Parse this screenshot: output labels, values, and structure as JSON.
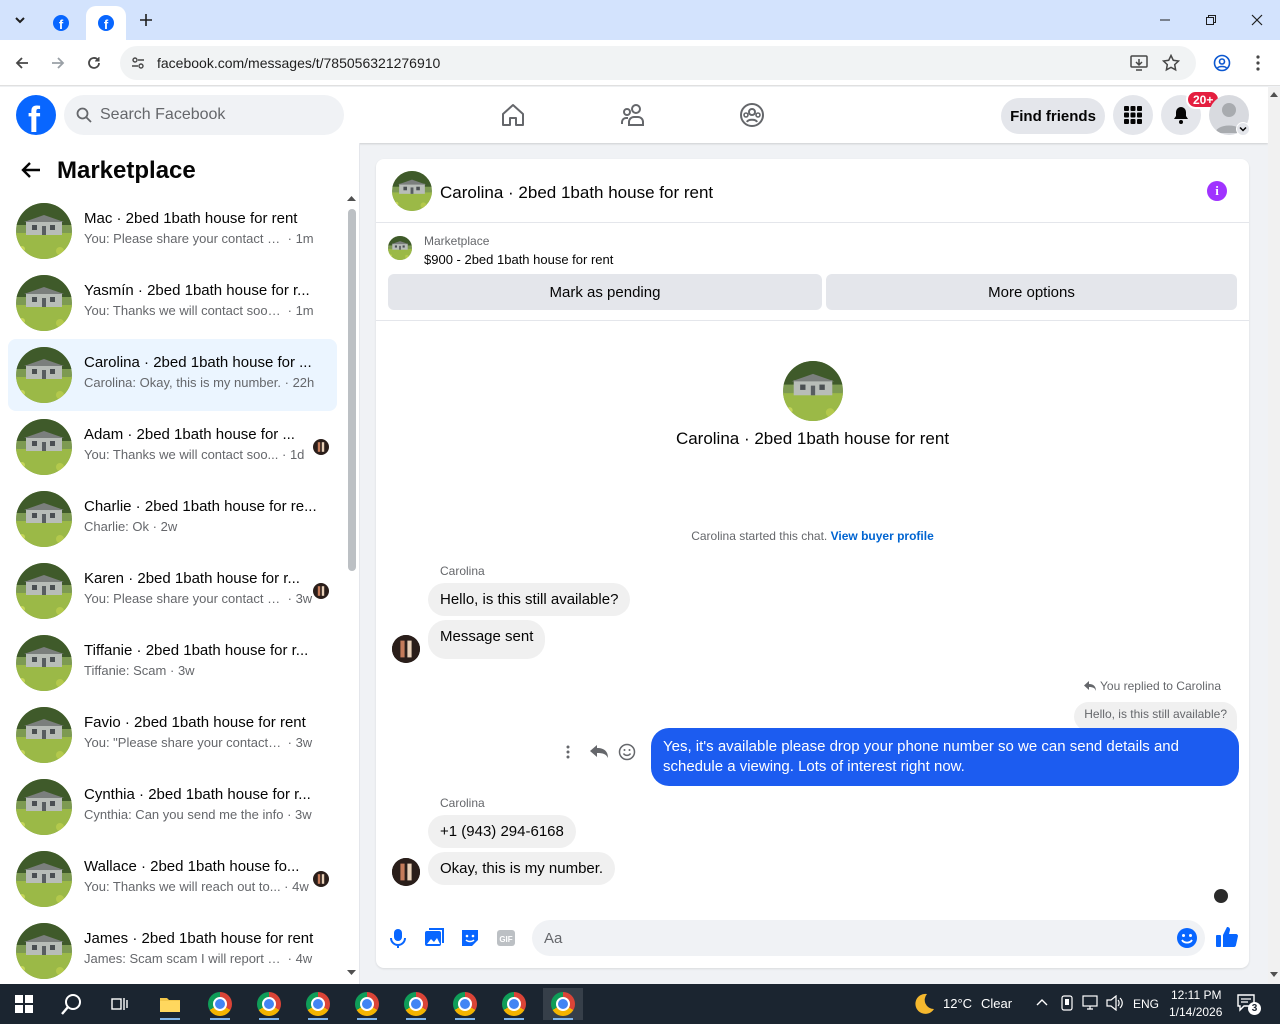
{
  "browser": {
    "url": "facebook.com/messages/t/785056321276910",
    "tabs": [
      {
        "icon": "facebook-icon",
        "active": false
      },
      {
        "icon": "facebook-icon",
        "active": true
      }
    ]
  },
  "facebook": {
    "search_placeholder": "Search Facebook",
    "find_friends": "Find friends",
    "notification_count": "20+"
  },
  "sidebar": {
    "title": "Marketplace",
    "conversations": [
      {
        "name": "Mac · 2bed 1bath house for rent",
        "preview": "You: Please share your contact nu...",
        "time": "1m"
      },
      {
        "name": "Yasmín · 2bed 1bath house for r...",
        "preview": "You: Thanks we will contact soon ...",
        "time": "1m"
      },
      {
        "name": "Carolina · 2bed 1bath house for ...",
        "preview": "Carolina: Okay, this is my number.",
        "time": "22h"
      },
      {
        "name": "Adam · 2bed 1bath house for ...",
        "preview": "You: Thanks we will contact soo...",
        "time": "1d"
      },
      {
        "name": "Charlie · 2bed 1bath house for re...",
        "preview": "Charlie: Ok",
        "time": "2w"
      },
      {
        "name": "Karen · 2bed 1bath house for r...",
        "preview": "You: Please share your contact n...",
        "time": "3w"
      },
      {
        "name": "Tiffanie · 2bed 1bath house for r...",
        "preview": "Tiffanie: Scam",
        "time": "3w"
      },
      {
        "name": "Favio · 2bed 1bath house for rent",
        "preview": "You: \"Please share your contact nu...",
        "time": "3w"
      },
      {
        "name": "Cynthia · 2bed 1bath house for r...",
        "preview": "Cynthia: Can you send me the info",
        "time": "3w"
      },
      {
        "name": "Wallace · 2bed 1bath house fo...",
        "preview": "You: Thanks we will reach out to...",
        "time": "4w"
      },
      {
        "name": "James · 2bed 1bath house for rent",
        "preview": "James: Scam scam I will report to c...",
        "time": "4w"
      }
    ]
  },
  "chat": {
    "title": "Carolina · 2bed 1bath house for rent",
    "marketplace_label": "Marketplace",
    "listing": "$900 - 2bed 1bath house for rent",
    "mark_pending": "Mark as pending",
    "more_options": "More options",
    "intro_name": "Carolina · 2bed 1bath house for rent",
    "started_text": "Carolina started this chat.",
    "view_profile": "View buyer profile",
    "sender_name": "Carolina",
    "msg1": "Hello, is this still available?",
    "msg2": "Message sent",
    "replied_to": "You replied to Carolina",
    "quoted": "Hello, is this still available?",
    "reply": "Yes, it's available please drop your phone number so we can send details and schedule a viewing. Lots of interest right now.",
    "msg3": "+1 (943) 294-6168",
    "msg4": "Okay, this is my number.",
    "composer_placeholder": "Aa"
  },
  "taskbar": {
    "weather": "12°C",
    "weather_desc": "Clear",
    "lang": "ENG",
    "time": "12:11 PM",
    "date": "1/14/2026",
    "notif_count": "3"
  },
  "colors": {
    "brand": "#0866ff",
    "outgoing_bubble": "#1c5cf0",
    "active_conv": "#ebf5ff",
    "badge": "#e41e3f"
  }
}
